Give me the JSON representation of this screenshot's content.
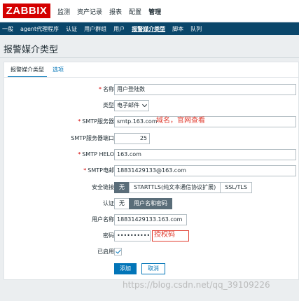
{
  "header": {
    "logo": "ZABBIX",
    "main_nav": [
      "监测",
      "资产记录",
      "报表",
      "配置",
      "管理"
    ],
    "main_nav_active": "管理"
  },
  "subnav": [
    "一般",
    "agent代理程序",
    "认证",
    "用户群组",
    "用户",
    "报警媒介类型",
    "脚本",
    "队列"
  ],
  "page_title": "报警媒介类型",
  "tabs": [
    "报警媒介类型",
    "选项"
  ],
  "form": {
    "name": {
      "label": "名称",
      "value": "用户登陆数"
    },
    "type": {
      "label": "类型",
      "value": "电子邮件"
    },
    "smtp_server": {
      "label": "SMTP服务器",
      "value": "smtp.163.com",
      "note": "域名，官网查看"
    },
    "smtp_port": {
      "label": "SMTP服务器端口",
      "value": "25"
    },
    "smtp_helo": {
      "label": "SMTP HELO",
      "value": "163.com"
    },
    "smtp_email": {
      "label": "SMTP电邮",
      "value": "18831429133@163.com"
    },
    "security": {
      "label": "安全链接",
      "options": [
        "无",
        "STARTTLS(纯文本通信协议扩展)",
        "SSL/TLS"
      ],
      "selected": "无"
    },
    "auth": {
      "label": "认证",
      "options": [
        "无",
        "用户名和密码"
      ],
      "selected": "用户名和密码"
    },
    "username": {
      "label": "用户名称",
      "value": "18831429133.163.com"
    },
    "password": {
      "label": "密码",
      "value": "•••••••••••••••",
      "note": "授权码"
    },
    "enabled": {
      "label": "已启用",
      "checked": true
    }
  },
  "buttons": {
    "add": "添加",
    "cancel": "取消"
  },
  "watermark": "https://blog.csdn.net/qq_39109226",
  "colors": {
    "brand": "#d40000",
    "subnav": "#0a466a",
    "accent": "#0275b8",
    "annotation": "#e03c2f"
  }
}
